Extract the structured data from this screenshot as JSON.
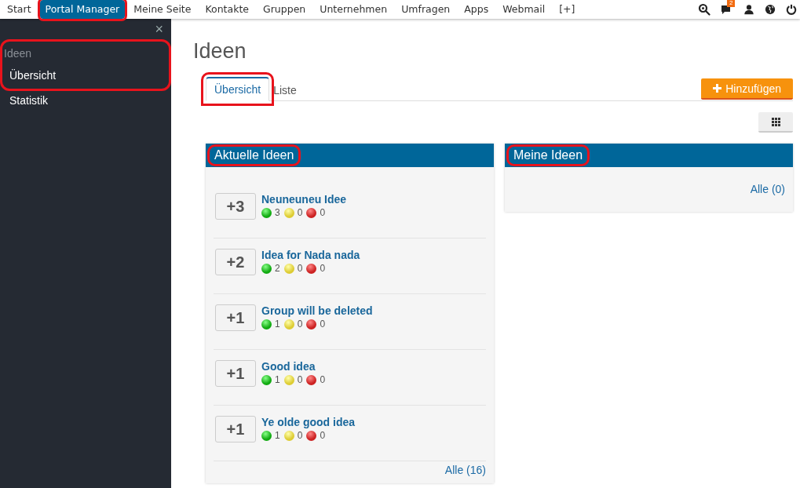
{
  "top_nav": {
    "items": [
      {
        "label": "Start",
        "selected": false,
        "highlighted": false
      },
      {
        "label": "Portal Manager",
        "selected": true,
        "highlighted": true
      },
      {
        "label": "Meine Seite",
        "selected": false,
        "highlighted": false
      },
      {
        "label": "Kontakte",
        "selected": false,
        "highlighted": false
      },
      {
        "label": "Gruppen",
        "selected": false,
        "highlighted": false
      },
      {
        "label": "Unternehmen",
        "selected": false,
        "highlighted": false
      },
      {
        "label": "Umfragen",
        "selected": false,
        "highlighted": false
      },
      {
        "label": "Apps",
        "selected": false,
        "highlighted": false
      },
      {
        "label": "Webmail",
        "selected": false,
        "highlighted": false
      },
      {
        "label": "[+]",
        "selected": false,
        "highlighted": false
      }
    ],
    "tools": [
      {
        "kind": "search"
      },
      {
        "kind": "messages",
        "badge": "2"
      },
      {
        "kind": "user"
      },
      {
        "kind": "globe"
      },
      {
        "kind": "power"
      }
    ]
  },
  "sidebar": {
    "close": "×",
    "sections": [
      {
        "highlighted": true,
        "heading": "Ideen",
        "items": [
          {
            "label": "Übersicht"
          }
        ]
      },
      {
        "highlighted": false,
        "items": [
          {
            "label": "Statistik"
          }
        ]
      }
    ]
  },
  "page": {
    "title": "Ideen",
    "tabs": [
      {
        "label": "Übersicht",
        "selected": true,
        "highlighted": true
      },
      {
        "label": "Liste",
        "selected": false,
        "highlighted": false
      }
    ],
    "add_button": "Hinzufügen",
    "panels": [
      {
        "title": "Aktuelle Ideen",
        "highlighted": true,
        "ideas": [
          {
            "score": "+3",
            "title": "Neuneuneu Idee",
            "up": "3",
            "neutral": "0",
            "down": "0"
          },
          {
            "score": "+2",
            "title": "Idea for Nada nada",
            "up": "2",
            "neutral": "0",
            "down": "0"
          },
          {
            "score": "+1",
            "title": "Group will be deleted",
            "up": "1",
            "neutral": "0",
            "down": "0"
          },
          {
            "score": "+1",
            "title": "Good idea",
            "up": "1",
            "neutral": "0",
            "down": "0"
          },
          {
            "score": "+1",
            "title": "Ye olde good idea",
            "up": "1",
            "neutral": "0",
            "down": "0"
          }
        ],
        "all_link": "Alle (16)"
      },
      {
        "title": "Meine Ideen",
        "highlighted": true,
        "all_link": "Alle (0)"
      }
    ]
  }
}
